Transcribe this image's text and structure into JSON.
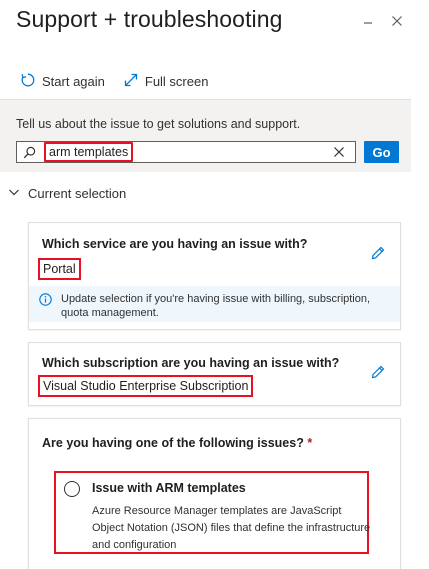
{
  "header": {
    "title": "Support + troubleshooting"
  },
  "toolbar": {
    "start_again": "Start again",
    "full_screen": "Full screen"
  },
  "issue": {
    "prompt": "Tell us about the issue to get solutions and support.",
    "search_value": "arm templates",
    "go_label": "Go"
  },
  "current_selection": {
    "label": "Current selection"
  },
  "service": {
    "question": "Which service are you having an issue with?",
    "answer": "Portal",
    "info": "Update selection if you're having issue with billing, subscription, quota management."
  },
  "subscription": {
    "question": "Which subscription are you having an issue with?",
    "answer": "Visual Studio Enterprise Subscription"
  },
  "issues": {
    "question": "Are you having one of the following issues?",
    "required_mark": "*",
    "option_title": "Issue with ARM templates",
    "option_desc": "Azure Resource Manager templates are JavaScript Object Notation (JSON) files that define the infrastructure and configuration"
  },
  "colors": {
    "accent": "#0078d4",
    "highlight": "#e81123",
    "info_bg": "#eff6fc"
  }
}
